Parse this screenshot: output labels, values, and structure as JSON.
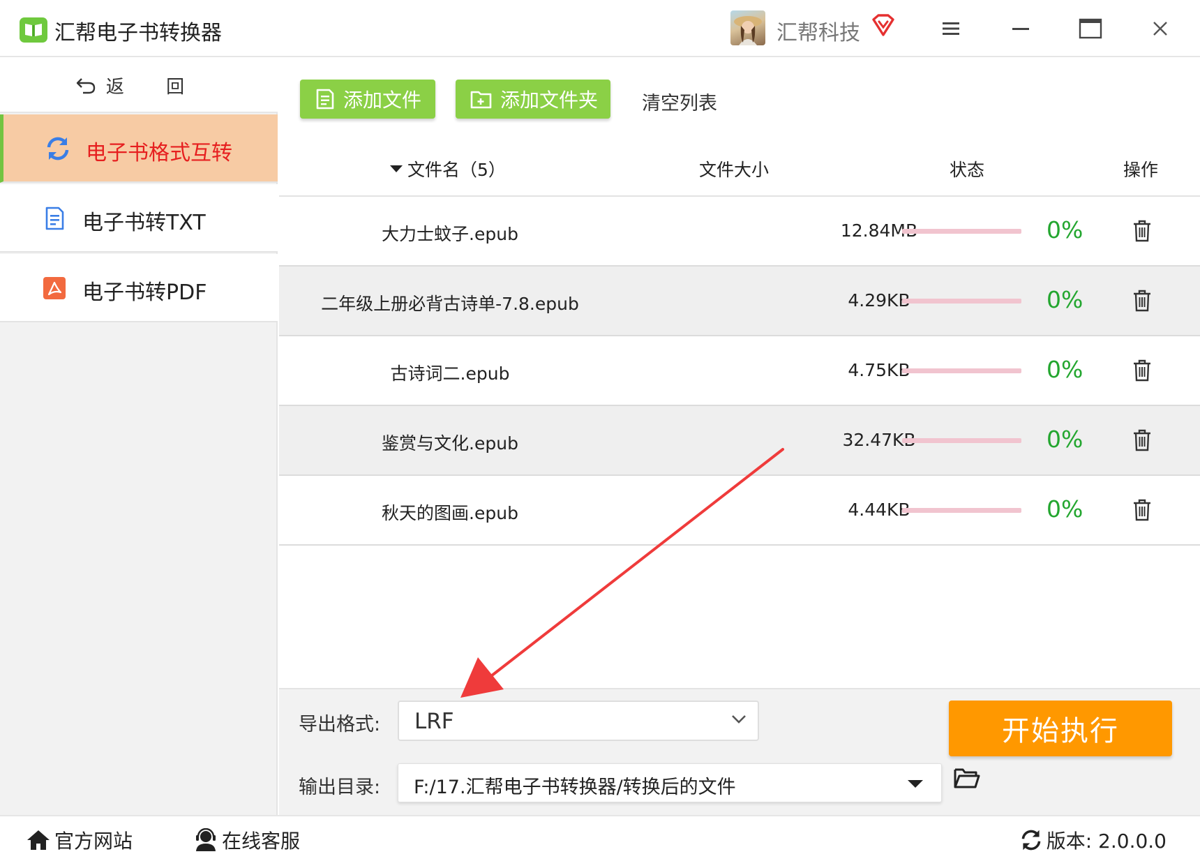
{
  "app": {
    "title": "汇帮电子书转换器",
    "brand": "汇帮科技"
  },
  "sidebar": {
    "back_label": "返 回",
    "items": [
      {
        "label": "电子书格式互转",
        "icon": "refresh-icon",
        "active": true
      },
      {
        "label": "电子书转TXT",
        "icon": "txt-document-icon",
        "active": false
      },
      {
        "label": "电子书转PDF",
        "icon": "pdf-icon",
        "active": false
      }
    ]
  },
  "toolbar": {
    "add_file": "添加文件",
    "add_folder": "添加文件夹",
    "clear_list": "清空列表"
  },
  "table": {
    "headers": {
      "name": "文件名（5）",
      "size": "文件大小",
      "status": "状态",
      "action": "操作"
    },
    "rows": [
      {
        "name": "大力士蚊子.epub",
        "size": "12.84MB",
        "progress": "0%"
      },
      {
        "name": "二年级上册必背古诗单-7.8.epub",
        "size": "4.29KB",
        "progress": "0%"
      },
      {
        "name": "古诗词二.epub",
        "size": "4.75KB",
        "progress": "0%"
      },
      {
        "name": "鉴赏与文化.epub",
        "size": "32.47KB",
        "progress": "0%"
      },
      {
        "name": "秋天的图画.epub",
        "size": "4.44KB",
        "progress": "0%"
      }
    ]
  },
  "output": {
    "format_label": "导出格式:",
    "format_value": "LRF",
    "dir_label": "输出目录:",
    "dir_value": "F:/17.汇帮电子书转换器/转换后的文件",
    "start_button": "开始执行"
  },
  "statusbar": {
    "website": "官方网站",
    "support": "在线客服",
    "version": "版本:  2.0.0.0"
  },
  "colors": {
    "accent_green": "#8bd046",
    "active_bg": "#f7cba4",
    "active_text": "#e61f1f",
    "start_orange": "#ff9800",
    "percent_green": "#23a62f",
    "progress_track": "#f1c4cf",
    "arrow_red": "#ef3b3b"
  }
}
